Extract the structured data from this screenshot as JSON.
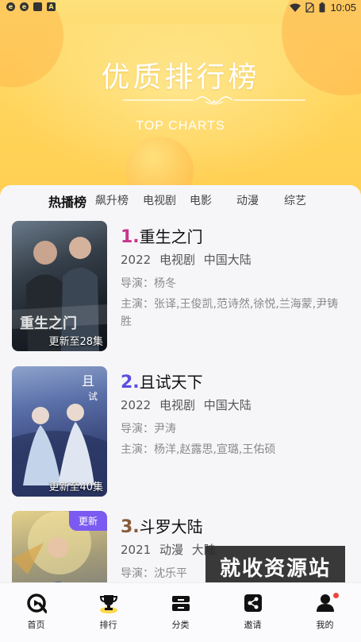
{
  "status_bar": {
    "time": "10:05",
    "colors": {
      "icon": "#333333"
    }
  },
  "header": {
    "title": "优质排行榜",
    "subtitle": "TOP CHARTS"
  },
  "tabs": [
    {
      "label": "热播榜",
      "active": true
    },
    {
      "label": "飙升榜",
      "active": false
    },
    {
      "label": "电视剧",
      "active": false
    },
    {
      "label": "电影",
      "active": false
    },
    {
      "label": "动漫",
      "active": false
    },
    {
      "label": "综艺",
      "active": false
    }
  ],
  "items": [
    {
      "rank": "1.",
      "rank_color": "#c8348c",
      "title": "重生之门",
      "year": "2022",
      "type": "电视剧",
      "region": "中国大陆",
      "director": "导演：杨冬",
      "cast": "主演：张译,王俊凯,范诗然,徐悦,兰海蒙,尹铸胜",
      "episode_badge": "更新至28集"
    },
    {
      "rank": "2.",
      "rank_color": "#5a4ee0",
      "title": "且试天下",
      "year": "2022",
      "type": "电视剧",
      "region": "中国大陆",
      "director": "导演：尹涛",
      "cast": "主演：杨洋,赵露思,宣璐,王佑硕",
      "episode_badge": "更新至40集"
    },
    {
      "rank": "3.",
      "rank_color": "#8a5a3a",
      "title": "斗罗大陆",
      "year": "2021",
      "type": "动漫",
      "region": "大陆",
      "director": "导演：沈乐平",
      "corner_badge": "更新"
    }
  ],
  "watermark": "就收资源站",
  "bottom_nav": [
    {
      "label": "首页",
      "icon": "home-logo-icon"
    },
    {
      "label": "排行",
      "icon": "trophy-icon",
      "active": true
    },
    {
      "label": "分类",
      "icon": "category-box-icon"
    },
    {
      "label": "邀请",
      "icon": "share-icon"
    },
    {
      "label": "我的",
      "icon": "user-icon",
      "has_dot": true
    }
  ]
}
